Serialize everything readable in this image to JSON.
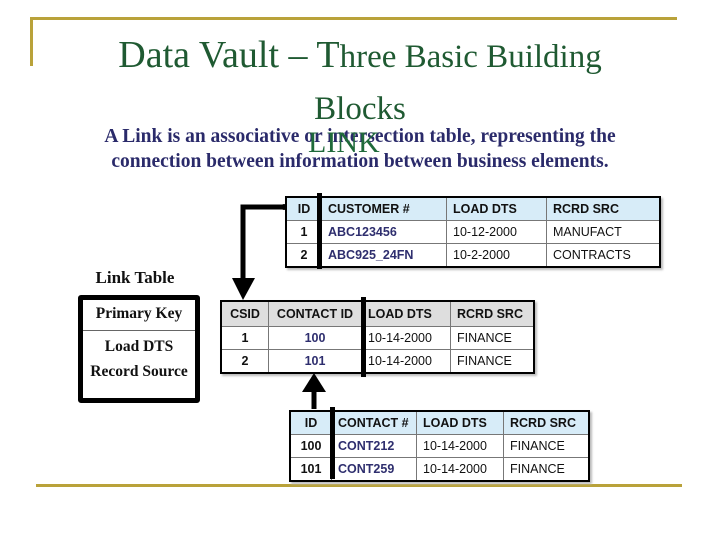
{
  "slide": {
    "title_part1": "Data Vault – T",
    "title_part2": "hree Basic Building",
    "title_line2": "Blocks",
    "overlay_word": "LINK",
    "description_line1": "A Link is an associative or intersection table, representing the",
    "description_line2": "connection between information between business elements."
  },
  "colors": {
    "accent_gold": "#b9a23a",
    "title_green": "#1f5a32",
    "description_navy": "#2a2a6a",
    "hub_header_bg": "#d7ecf8",
    "link_header_bg": "#dedede"
  },
  "legend": {
    "title": "Link Table",
    "items": [
      "Primary Key",
      "Load DTS",
      "Record Source"
    ]
  },
  "hub_customer": {
    "headers": [
      "ID",
      "CUSTOMER #",
      "LOAD DTS",
      "RCRD SRC"
    ],
    "rows": [
      [
        "1",
        "ABC123456",
        "10-12-2000",
        "MANUFACT"
      ],
      [
        "2",
        "ABC925_24FN",
        "10-2-2000",
        "CONTRACTS"
      ]
    ]
  },
  "link_table": {
    "headers": [
      "CSID",
      "CONTACT ID",
      "LOAD DTS",
      "RCRD SRC"
    ],
    "rows": [
      [
        "1",
        "100",
        "10-14-2000",
        "FINANCE"
      ],
      [
        "2",
        "101",
        "10-14-2000",
        "FINANCE"
      ]
    ]
  },
  "hub_contact": {
    "headers": [
      "ID",
      "CONTACT #",
      "LOAD DTS",
      "RCRD SRC"
    ],
    "rows": [
      [
        "100",
        "CONT212",
        "10-14-2000",
        "FINANCE"
      ],
      [
        "101",
        "CONT259",
        "10-14-2000",
        "FINANCE"
      ]
    ]
  },
  "connectors": [
    {
      "from": "hub_customer.ID",
      "to": "link_table.CSID",
      "arrow": "down"
    },
    {
      "from": "hub_contact.ID",
      "to": "link_table.CONTACT ID",
      "arrow": "up"
    }
  ]
}
